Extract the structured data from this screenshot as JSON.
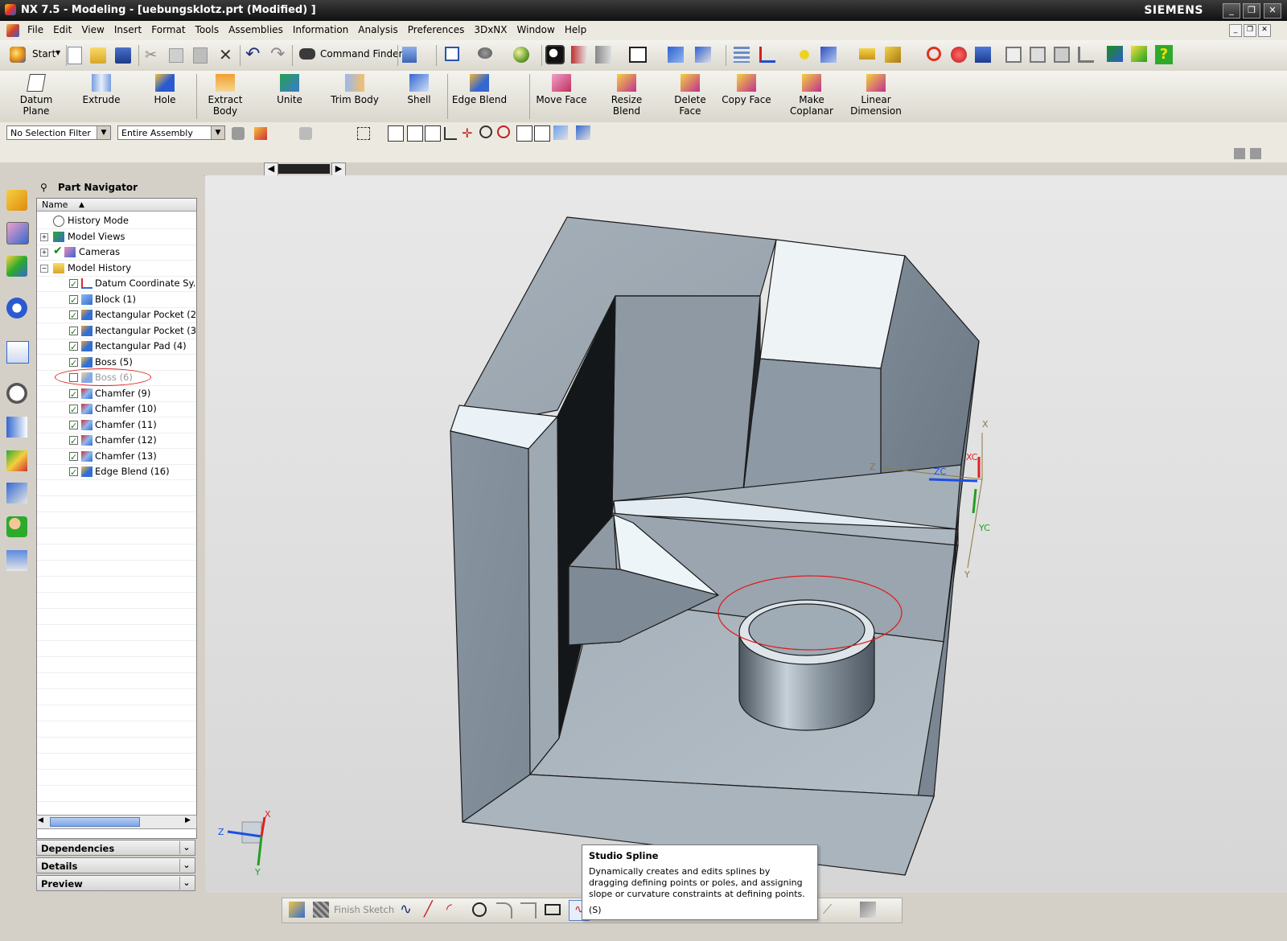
{
  "window": {
    "title": "NX 7.5 - Modeling - [uebungsklotz.prt (Modified) ]",
    "brand": "SIEMENS"
  },
  "menu": [
    "File",
    "Edit",
    "View",
    "Insert",
    "Format",
    "Tools",
    "Assemblies",
    "Information",
    "Analysis",
    "Preferences",
    "3DxNX",
    "Window",
    "Help"
  ],
  "toolbar1": {
    "start_label": "Start",
    "command_finder_label": "Command Finder"
  },
  "toolbar2": [
    {
      "label1": "Datum",
      "label2": "Plane"
    },
    {
      "label1": "Extrude",
      "label2": ""
    },
    {
      "label1": "Hole",
      "label2": ""
    },
    {
      "label1": "Extract",
      "label2": "Body"
    },
    {
      "label1": "Unite",
      "label2": ""
    },
    {
      "label1": "Trim Body",
      "label2": ""
    },
    {
      "label1": "Shell",
      "label2": ""
    },
    {
      "label1": "Edge Blend",
      "label2": ""
    },
    {
      "label1": "Move Face",
      "label2": ""
    },
    {
      "label1": "Resize",
      "label2": "Blend"
    },
    {
      "label1": "Delete",
      "label2": "Face"
    },
    {
      "label1": "Copy Face",
      "label2": ""
    },
    {
      "label1": "Make",
      "label2": "Coplanar"
    },
    {
      "label1": "Linear",
      "label2": "Dimension"
    }
  ],
  "selection": {
    "filter": "No Selection Filter",
    "scope": "Entire Assembly"
  },
  "navigator": {
    "title": "Part Navigator",
    "column": "Name",
    "rows": [
      {
        "label": "History Mode"
      },
      {
        "label": "Model Views"
      },
      {
        "label": "Cameras"
      },
      {
        "label": "Model History"
      },
      {
        "label": "Datum Coordinate Sy..."
      },
      {
        "label": "Block (1)"
      },
      {
        "label": "Rectangular Pocket (2)"
      },
      {
        "label": "Rectangular Pocket (3)"
      },
      {
        "label": "Rectangular Pad (4)"
      },
      {
        "label": "Boss (5)"
      },
      {
        "label": "Boss (6)"
      },
      {
        "label": "Chamfer (9)"
      },
      {
        "label": "Chamfer (10)"
      },
      {
        "label": "Chamfer (11)"
      },
      {
        "label": "Chamfer (12)"
      },
      {
        "label": "Chamfer (13)"
      },
      {
        "label": "Edge Blend (16)"
      }
    ],
    "panels": [
      "Dependencies",
      "Details",
      "Preview"
    ]
  },
  "csys": {
    "x": "X",
    "y": "Y",
    "z": "Z",
    "xc": "XC",
    "yc": "YC",
    "zc": "ZC"
  },
  "bottom_toolbar": {
    "finish_sketch": "Finish Sketch"
  },
  "tooltip": {
    "title": "Studio Spline",
    "body": "Dynamically creates and edits splines by dragging defining points or poles, and assigning slope or curvature constraints at defining points.",
    "shortcut": "(S)"
  },
  "colors": {
    "highlight_circle": "#e01a1a",
    "feature_icon_blue": "#2f6fd6",
    "checkbox_green": "#118811"
  }
}
